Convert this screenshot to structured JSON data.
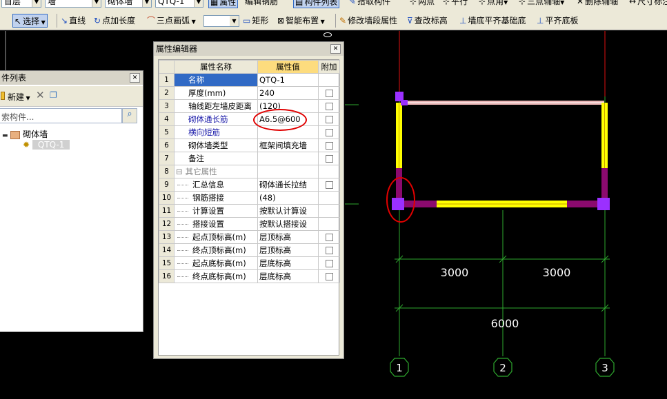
{
  "toolbar_top": {
    "floor_combo": "首层",
    "type_combo": "墙",
    "subtype_combo": "砌体墙",
    "component_combo": "QTQ-1",
    "btn_attribute": "属性",
    "btn_edit_rebar": "编辑钢筋",
    "btn_component_list": "构件列表",
    "btn_pick_component": "拾取构件",
    "btn_two_points": "两点",
    "btn_parallel": "平行",
    "btn_point_angle": "点角",
    "btn_three_point_axis": "三点辅轴",
    "btn_delete_axis": "删除辅轴",
    "btn_dimension": "尺寸标注"
  },
  "toolbar_draw": {
    "select": "选择",
    "line": "直线",
    "point_length": "点加长度",
    "three_arc": "三点画弧",
    "rect": "矩形",
    "smart_layout": "智能布置",
    "modify_segment": "修改墙段属性",
    "modify_elev": "查改标高",
    "wall_bottom_align": "墙底平齐基础底",
    "flat_bottom": "平齐底板"
  },
  "component_list": {
    "title": "件列表",
    "new_label": "新建",
    "search_placeholder": "索构件...",
    "tree_root": "砌体墙",
    "tree_child": "QTQ-1"
  },
  "property_editor": {
    "title": "属性编辑器",
    "col_name": "属性名称",
    "col_value": "属性值",
    "col_extra": "附加",
    "rows": [
      {
        "num": "1",
        "name": "名称",
        "value": "QTQ-1",
        "style": "sel",
        "check": false
      },
      {
        "num": "2",
        "name": "厚度(mm)",
        "value": "240",
        "style": "",
        "check": true
      },
      {
        "num": "3",
        "name": "轴线距左墙皮距离",
        "value": "(120)",
        "style": "",
        "check": true
      },
      {
        "num": "4",
        "name": "砌体通长筋",
        "value": "A6.5@600",
        "style": "blue",
        "check": true
      },
      {
        "num": "5",
        "name": "横向短筋",
        "value": "",
        "style": "blue",
        "check": true
      },
      {
        "num": "6",
        "name": "砌体墙类型",
        "value": "框架间填充墙",
        "style": "",
        "check": true
      },
      {
        "num": "7",
        "name": "备注",
        "value": "",
        "style": "",
        "check": true
      },
      {
        "num": "8",
        "name": "其它属性",
        "value": "",
        "style": "group",
        "check": false
      },
      {
        "num": "9",
        "name": "汇总信息",
        "value": "砌体通长拉结",
        "style": "sub",
        "check": true
      },
      {
        "num": "10",
        "name": "钢筋搭接",
        "value": "(48)",
        "style": "sub",
        "check": false
      },
      {
        "num": "11",
        "name": "计算设置",
        "value": "按默认计算设",
        "style": "sub",
        "check": false
      },
      {
        "num": "12",
        "name": "搭接设置",
        "value": "按默认搭接设",
        "style": "sub",
        "check": false
      },
      {
        "num": "13",
        "name": "起点顶标高(m)",
        "value": "层顶标高",
        "style": "sub",
        "check": true
      },
      {
        "num": "14",
        "name": "终点顶标高(m)",
        "value": "层顶标高",
        "style": "sub",
        "check": true
      },
      {
        "num": "15",
        "name": "起点底标高(m)",
        "value": "层底标高",
        "style": "sub",
        "check": true
      },
      {
        "num": "16",
        "name": "终点底标高(m)",
        "value": "层底标高",
        "style": "sub",
        "check": true
      }
    ]
  },
  "drawing": {
    "dim_left": "3000",
    "dim_right": "3000",
    "dim_total": "6000",
    "axis_1": "1",
    "axis_2": "2",
    "axis_3": "3",
    "colors": {
      "axis_red": "#e01010",
      "grid_green": "#2ea82e",
      "wall_yellow": "#ffff00",
      "wall_purple": "#8b0a6e",
      "column_violet": "#9b30ff",
      "annotation_red": "#e00000"
    }
  }
}
